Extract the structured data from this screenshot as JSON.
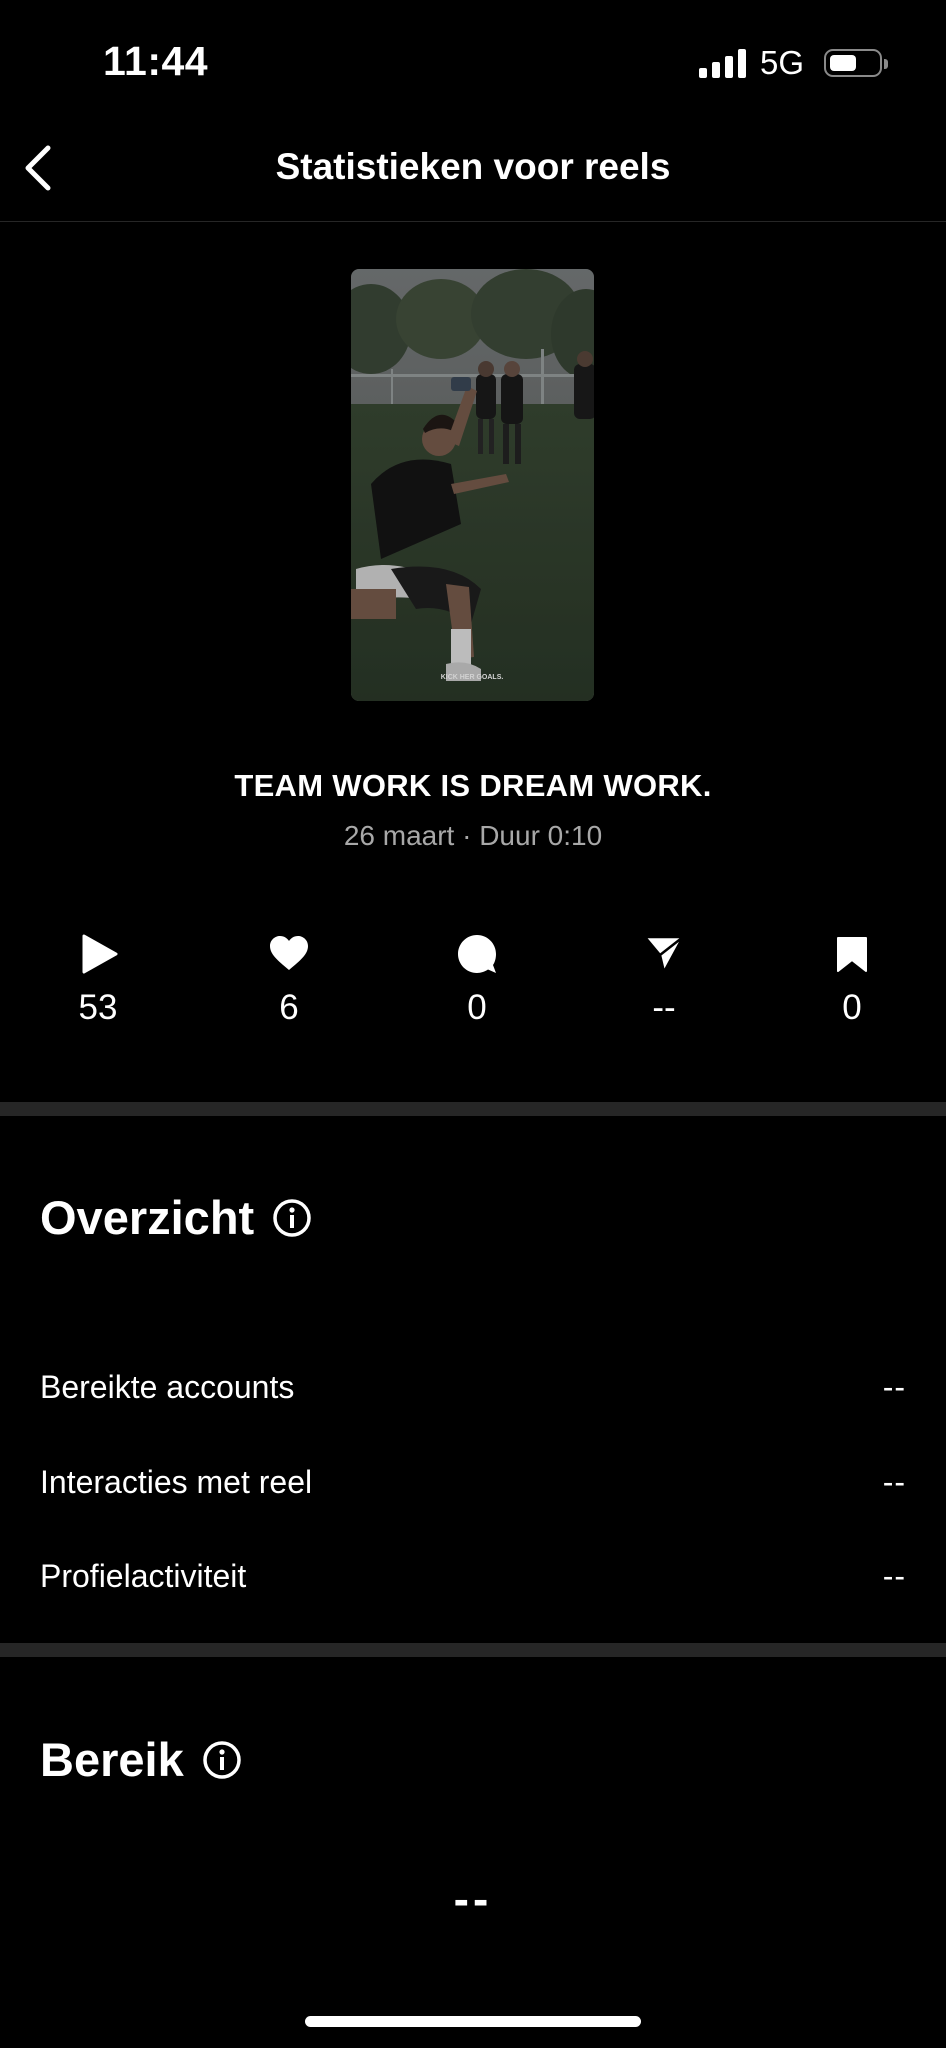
{
  "status_bar": {
    "time": "11:44",
    "network": "5G"
  },
  "header": {
    "title": "Statistieken voor reels"
  },
  "reel": {
    "caption_on_video": "KICK HER GOALS.",
    "title": "TEAM WORK IS DREAM WORK.",
    "meta": "26 maart · Duur 0:10"
  },
  "stats": [
    {
      "icon": "play-icon",
      "value": "53"
    },
    {
      "icon": "heart-icon",
      "value": "6"
    },
    {
      "icon": "comment-icon",
      "value": "0"
    },
    {
      "icon": "share-icon",
      "value": "--"
    },
    {
      "icon": "save-icon",
      "value": "0"
    }
  ],
  "overview": {
    "title": "Overzicht",
    "rows": [
      {
        "label": "Bereikte accounts",
        "value": "--"
      },
      {
        "label": "Interacties met reel",
        "value": "--"
      },
      {
        "label": "Profielactiviteit",
        "value": "--"
      }
    ]
  },
  "reach": {
    "title": "Bereik",
    "value": "--"
  },
  "colors": {
    "background": "#000000",
    "separator": "#262626",
    "secondary_text": "#a8a8a8"
  }
}
